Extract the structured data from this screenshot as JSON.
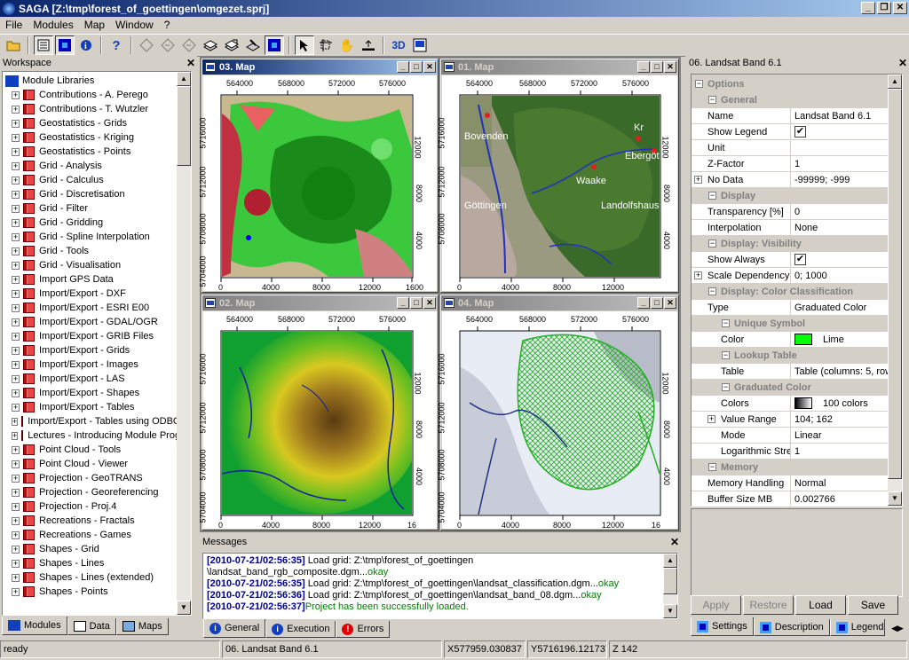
{
  "window": {
    "title": "SAGA [Z:\\tmp\\forest_of_goettingen\\omgezet.sprj]"
  },
  "menu": [
    "File",
    "Modules",
    "Map",
    "Window",
    "?"
  ],
  "workspace": {
    "title": "Workspace",
    "root": "Module Libraries",
    "items": [
      "Contributions - A. Perego",
      "Contributions - T. Wutzler",
      "Geostatistics - Grids",
      "Geostatistics - Kriging",
      "Geostatistics - Points",
      "Grid - Analysis",
      "Grid - Calculus",
      "Grid - Discretisation",
      "Grid - Filter",
      "Grid - Gridding",
      "Grid - Spline Interpolation",
      "Grid - Tools",
      "Grid - Visualisation",
      "Import GPS Data",
      "Import/Export - DXF",
      "Import/Export - ESRI E00",
      "Import/Export - GDAL/OGR",
      "Import/Export - GRIB Files",
      "Import/Export - Grids",
      "Import/Export - Images",
      "Import/Export - LAS",
      "Import/Export - Shapes",
      "Import/Export - Tables",
      "Import/Export - Tables using ODBC",
      "Lectures - Introducing Module Programming",
      "Point Cloud - Tools",
      "Point Cloud - Viewer",
      "Projection - GeoTRANS",
      "Projection - Georeferencing",
      "Projection - Proj.4",
      "Recreations - Fractals",
      "Recreations - Games",
      "Shapes - Grid",
      "Shapes - Lines",
      "Shapes - Lines (extended)",
      "Shapes - Points"
    ],
    "tabs": [
      "Modules",
      "Data",
      "Maps"
    ]
  },
  "maps": {
    "m3": {
      "title": "03. Map",
      "xticks": [
        "564000",
        "568000",
        "572000",
        "576000"
      ],
      "ylabels": [
        "5716000",
        "5712000",
        "5708000",
        "5704000"
      ],
      "xbottom": [
        "0",
        "4000",
        "8000",
        "12000",
        "1600"
      ],
      "yright": [
        "12000",
        "8000",
        "4000"
      ]
    },
    "m1": {
      "title": "01. Map",
      "xticks": [
        "564000",
        "568000",
        "572000",
        "576000"
      ],
      "ylabels": [
        "5716000",
        "5712000",
        "5708000"
      ],
      "xbottom": [
        "0",
        "4000",
        "8000",
        "12000"
      ],
      "yright": [
        "12000",
        "8000",
        "4000"
      ],
      "places": [
        "Bovenden",
        "Göttingen",
        "Waake",
        "Ebergötzen",
        "Landolfshausen",
        "Kr"
      ]
    },
    "m2": {
      "title": "02. Map",
      "xticks": [
        "564000",
        "568000",
        "572000",
        "576000"
      ],
      "ylabels": [
        "5716000",
        "5712000",
        "5708000",
        "5704000"
      ],
      "xbottom": [
        "0",
        "4000",
        "8000",
        "12000",
        "16"
      ],
      "yright": [
        "12000",
        "8000",
        "4000"
      ]
    },
    "m4": {
      "title": "04. Map",
      "xticks": [
        "564000",
        "568000",
        "572000",
        "576000"
      ],
      "ylabels": [
        "5716000",
        "5712000",
        "5708000",
        "5704000"
      ],
      "xbottom": [
        "0",
        "4000",
        "8000",
        "12000",
        "16"
      ],
      "yright": [
        "12000",
        "8000",
        "4000"
      ]
    }
  },
  "messages": {
    "title": "Messages",
    "lines": [
      {
        "ts": "[2010-07-21/02:56:35]",
        "text": " Load grid: Z:\\tmp\\forest_of_goettingen"
      },
      {
        "ts": "",
        "text": "\\landsat_band_rgb_composite.dgm...",
        "ok": "okay"
      },
      {
        "ts": "[2010-07-21/02:56:35]",
        "text": " Load grid: Z:\\tmp\\forest_of_goettingen\\landsat_classification.dgm...",
        "ok": "okay"
      },
      {
        "ts": "[2010-07-21/02:56:36]",
        "text": " Load grid: Z:\\tmp\\forest_of_goettingen\\landsat_band_08.dgm...",
        "ok": "okay"
      },
      {
        "ts": "[2010-07-21/02:56:37]",
        "text": "",
        "ok": "Project has been successfully loaded."
      }
    ],
    "tabs": [
      "General",
      "Execution",
      "Errors"
    ]
  },
  "props": {
    "title": "06. Landsat Band 6.1",
    "rows": [
      {
        "t": "g",
        "l": "Options",
        "d": 0
      },
      {
        "t": "g",
        "l": "General",
        "d": 1
      },
      {
        "l": "Name",
        "v": "Landsat Band 6.1"
      },
      {
        "l": "Show Legend",
        "chk": "✔"
      },
      {
        "l": "Unit",
        "v": ""
      },
      {
        "l": "Z-Factor",
        "v": "1"
      },
      {
        "l": "No Data",
        "v": "-99999; -999",
        "plus": "+"
      },
      {
        "t": "g",
        "l": "Display",
        "d": 1
      },
      {
        "l": "Transparency [%]",
        "v": "0"
      },
      {
        "l": "Interpolation",
        "v": "None"
      },
      {
        "t": "g",
        "l": "Display: Visibility",
        "d": 1
      },
      {
        "l": "Show Always",
        "chk": "✔"
      },
      {
        "l": "Scale Dependency",
        "v": "0; 1000",
        "plus": "+"
      },
      {
        "t": "g",
        "l": "Display: Color Classification",
        "d": 1
      },
      {
        "l": "Type",
        "v": "Graduated Color"
      },
      {
        "t": "g",
        "l": "Unique Symbol",
        "d": 2
      },
      {
        "l": "Color",
        "v": "Lime",
        "sw": "#00ff00",
        "d": 2
      },
      {
        "t": "g",
        "l": "Lookup Table",
        "d": 2
      },
      {
        "l": "Table",
        "v": "Table (columns: 5, rows",
        "d": 2
      },
      {
        "t": "g",
        "l": "Graduated Color",
        "d": 2
      },
      {
        "l": "Colors",
        "v": "100 colors",
        "grad": true,
        "d": 2
      },
      {
        "l": "Value Range",
        "v": "104; 162",
        "plus": "+",
        "d": 2
      },
      {
        "l": "Mode",
        "v": "Linear",
        "d": 2
      },
      {
        "l": "Logarithmic Stretch",
        "v": "1",
        "d": 2
      },
      {
        "t": "g",
        "l": "Memory",
        "d": 1
      },
      {
        "l": "Memory Handling",
        "v": "Normal"
      },
      {
        "l": "Buffer Size MB",
        "v": "0.002766"
      }
    ],
    "buttons": [
      "Apply",
      "Restore",
      "Load",
      "Save"
    ],
    "tabs": [
      "Settings",
      "Description",
      "Legend"
    ]
  },
  "status": [
    "ready",
    "06. Landsat Band 6.1",
    "X577959.030837",
    "Y5716196.121737",
    "Z 142"
  ]
}
